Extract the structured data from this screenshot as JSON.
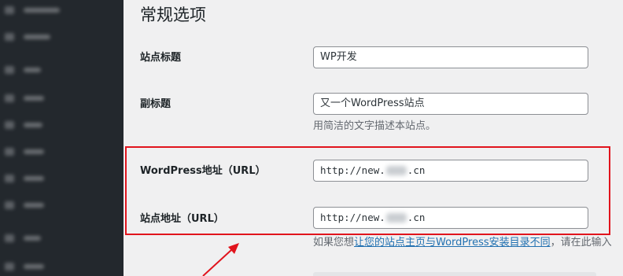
{
  "page": {
    "title": "常规选项"
  },
  "settings": {
    "site_title": {
      "label": "站点标题",
      "value": "WP开发"
    },
    "tagline": {
      "label": "副标题",
      "value": "又一个WordPress站点",
      "description": "用简洁的文字描述本站点。"
    },
    "wordpress_url": {
      "label": "WordPress地址（URL）",
      "value_prefix": "http://new.",
      "value_suffix": ".cn"
    },
    "site_url": {
      "label": "站点地址（URL）",
      "value_prefix": "http://new.",
      "value_suffix": ".cn",
      "description_before": "如果您想",
      "description_link": "让您的站点主页与WordPress安装目录不同",
      "description_after": "，请在此输入"
    }
  },
  "annotation": {
    "highlight_color": "#e1141d"
  },
  "colors": {
    "sidebar_bg": "#23282d",
    "content_bg": "#f0f0f1",
    "link": "#2271b1"
  }
}
